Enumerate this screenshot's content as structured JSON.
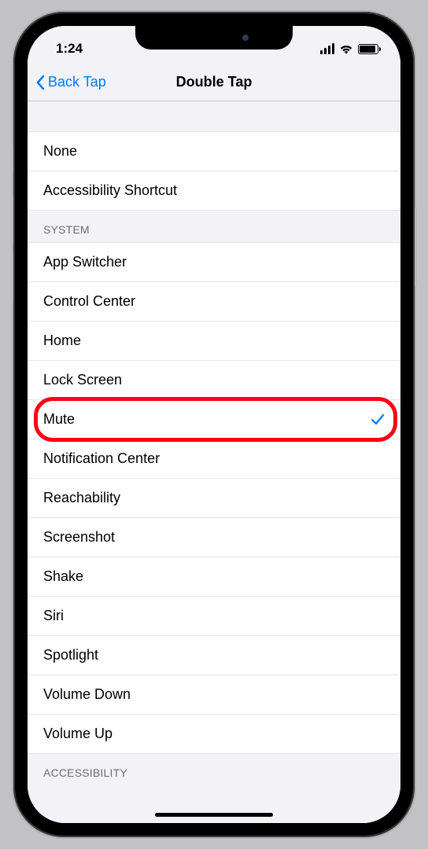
{
  "status": {
    "time": "1:24"
  },
  "nav": {
    "back_label": "Back Tap",
    "title": "Double Tap"
  },
  "group1": {
    "items": [
      {
        "label": "None"
      },
      {
        "label": "Accessibility Shortcut"
      }
    ]
  },
  "group_system": {
    "header": "SYSTEM",
    "items": [
      {
        "label": "App Switcher"
      },
      {
        "label": "Control Center"
      },
      {
        "label": "Home"
      },
      {
        "label": "Lock Screen"
      },
      {
        "label": "Mute",
        "selected": true,
        "highlighted": true
      },
      {
        "label": "Notification Center"
      },
      {
        "label": "Reachability"
      },
      {
        "label": "Screenshot"
      },
      {
        "label": "Shake"
      },
      {
        "label": "Siri"
      },
      {
        "label": "Spotlight"
      },
      {
        "label": "Volume Down"
      },
      {
        "label": "Volume Up"
      }
    ]
  },
  "group_accessibility": {
    "header": "ACCESSIBILITY"
  }
}
